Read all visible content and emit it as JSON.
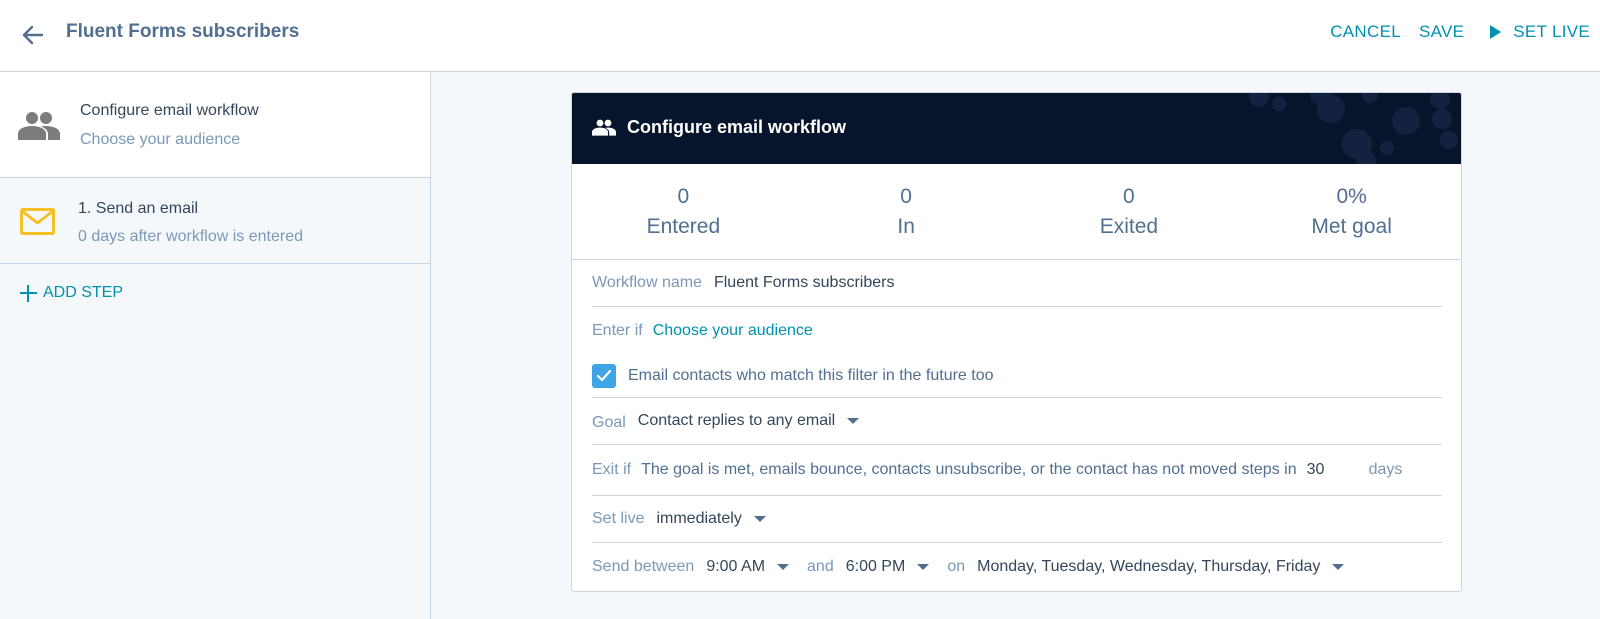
{
  "header": {
    "title": "Fluent Forms subscribers",
    "actions": {
      "cancel": "CANCEL",
      "save": "SAVE",
      "set_live": "SET LIVE"
    }
  },
  "sidebar": {
    "cards": [
      {
        "title": "Configure email workflow",
        "subtitle": "Choose your audience",
        "icon": "people-icon"
      },
      {
        "title": "1. Send an email",
        "subtitle": "0 days after workflow is entered",
        "icon": "envelope-icon"
      }
    ],
    "add_step": "ADD STEP"
  },
  "panel": {
    "title": "Configure email workflow",
    "stats": [
      {
        "value": "0",
        "label": "Entered"
      },
      {
        "value": "0",
        "label": "In"
      },
      {
        "value": "0",
        "label": "Exited"
      },
      {
        "value": "0%",
        "label": "Met goal"
      }
    ],
    "workflow_name": {
      "label": "Workflow name",
      "value": "Fluent Forms subscribers"
    },
    "enter_if": {
      "label": "Enter if",
      "link": "Choose your audience"
    },
    "future_filter": {
      "label": "Email contacts who match this filter in the future too",
      "checked": true
    },
    "goal": {
      "label": "Goal",
      "value": "Contact replies to any email"
    },
    "exit_if": {
      "label": "Exit if",
      "text": "The goal is met, emails bounce, contacts unsubscribe, or the contact has not moved steps in",
      "days_value": "30",
      "days_unit": "days"
    },
    "set_live": {
      "label": "Set live",
      "value": "immediately"
    },
    "send_between": {
      "label": "Send between",
      "start": "9:00 AM",
      "and": "and",
      "end": "6:00 PM",
      "on": "on",
      "days": "Monday, Tuesday, Wednesday, Thursday, Friday"
    }
  },
  "colors": {
    "accent": "#0091ae",
    "header_dark": "#07152c",
    "checkbox": "#3ea4e3",
    "email_icon": "#f5c26b"
  }
}
